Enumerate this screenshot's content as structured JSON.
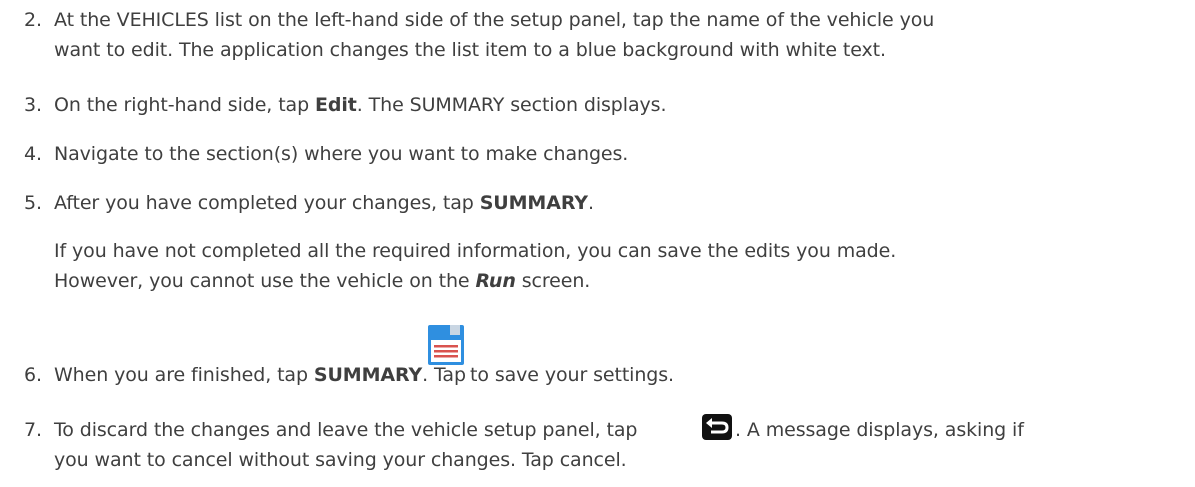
{
  "steps": [
    {
      "num": "2.",
      "lines": [
        "At the VEHICLES list on the left-hand side of the setup panel, tap the name of the vehicle you",
        "want to edit. The application changes the list item to a blue background with white text."
      ]
    },
    {
      "num": "3.",
      "pre": "On the right-hand side, tap ",
      "bold": "Edit",
      "post": ". The SUMMARY section displays."
    },
    {
      "num": "4.",
      "text": "Navigate to the section(s) where you want to make changes."
    },
    {
      "num": "5.",
      "pre": "After you have completed your changes, tap ",
      "bold": "SUMMARY",
      "post": ".",
      "note_line1": "If you have not completed all the required information, you can save the edits you made.",
      "note_pre": "However, you cannot use the vehicle on the ",
      "note_bold": "Run",
      "note_post": " screen."
    },
    {
      "num": "6.",
      "pre": "When you are finished, tap ",
      "bold": "SUMMARY",
      "mid": ". Tap ",
      "post": " to save your settings.",
      "icon": "save-icon"
    },
    {
      "num": "7.",
      "pre": "To discard the changes and leave the vehicle setup panel, tap ",
      "post": ". A message displays, asking if",
      "line2": "you want to cancel without saving your changes. Tap cancel.",
      "icon": "back-icon"
    }
  ],
  "colors": {
    "text": "#3f3f3f",
    "save_icon_blue": "#2f8fe0",
    "save_icon_red": "#d9534f",
    "back_icon_bg": "#111111"
  }
}
